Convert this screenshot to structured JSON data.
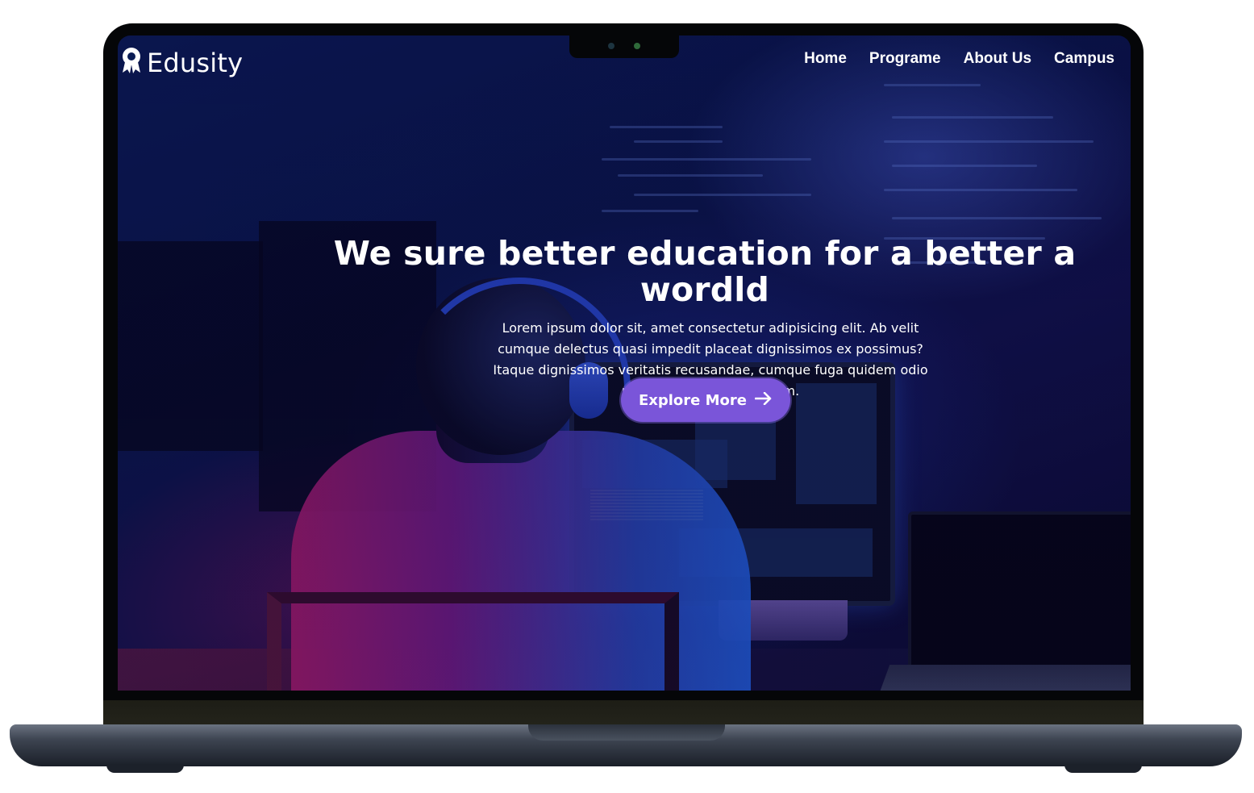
{
  "brand": {
    "name": "Edusity",
    "icon": "award-badge-icon"
  },
  "nav": {
    "items": [
      {
        "label": "Home"
      },
      {
        "label": "Programe"
      },
      {
        "label": "About Us"
      },
      {
        "label": "Campus"
      }
    ]
  },
  "hero": {
    "title": "We sure better education for a better a wordld",
    "description": "Lorem ipsum dolor sit, amet consectetur adipisicing elit. Ab velit cumque delectus quasi impedit placeat dignissimos ex possimus? Itaque dignissimos veritatis recusandae, cumque fuga quidem odio minima atque velit veniam.",
    "cta_label": "Explore More",
    "cta_icon": "arrow-right-icon"
  },
  "colors": {
    "accent": "#7a55d9",
    "overlay": "#08003a",
    "text": "#ffffff"
  }
}
